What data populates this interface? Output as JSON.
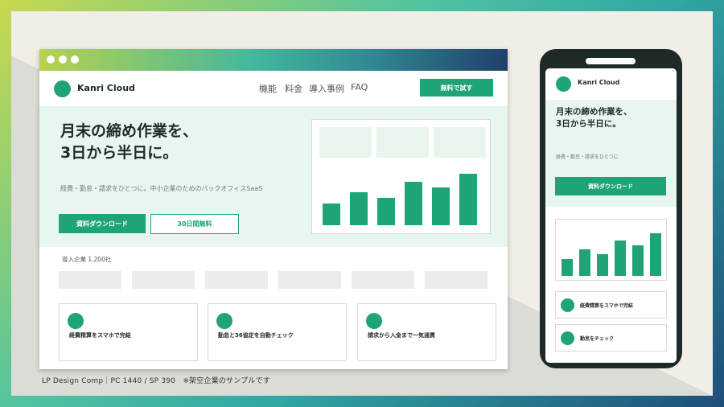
{
  "colors": {
    "accent": "#1fa476",
    "hero_bg": "#e7f6ee",
    "text": "#1e2a2a"
  },
  "desktop": {
    "brand": "Kanri Cloud",
    "nav": [
      "機能",
      "料金",
      "導入事例",
      "FAQ"
    ],
    "cta_label": "無料で試す",
    "hero": {
      "title_line1": "月末の締め作業を、",
      "title_line2": "3日から半日に。",
      "subtitle": "経費・勤怠・請求をひとつに。中小企業のためのバックオフィスSaaS",
      "primary_button": "資料ダウンロード",
      "secondary_button": "30日間無料"
    },
    "chart_bars": [
      0.38,
      0.58,
      0.49,
      0.77,
      0.67,
      0.92
    ],
    "clients_label": "導入企業 1,200社",
    "features": [
      "経費精算をスマホで完結",
      "勤怠と36協定を自動チェック",
      "請求から入金まで一気通貫"
    ]
  },
  "mobile": {
    "brand": "Kanri Cloud",
    "title_line1": "月末の締め作業を、",
    "title_line2": "3日から半日に。",
    "subtitle": "経費・勤怠・請求をひとつに",
    "button": "資料ダウンロード",
    "chart_bars": [
      0.35,
      0.54,
      0.45,
      0.72,
      0.62,
      0.87
    ],
    "features": [
      "経費精算をスマホで完結",
      "勤怠をチェック"
    ]
  },
  "caption": "LP Design Comp｜PC 1440 / SP 390　※架空企業のサンプルです"
}
